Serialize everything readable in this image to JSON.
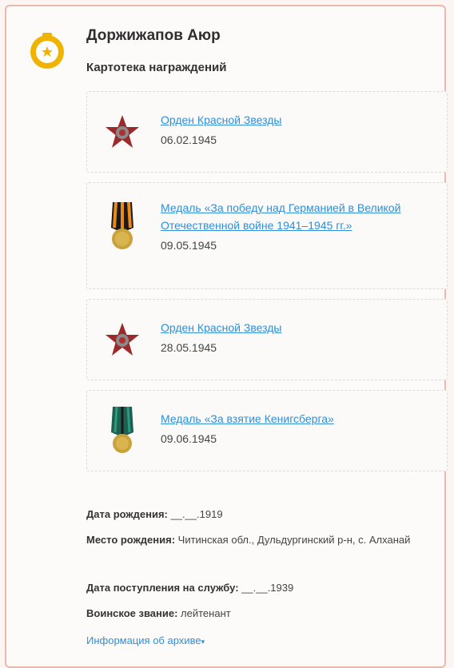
{
  "person": {
    "name": "Доржижапов Аюр",
    "subtitle": "Картотека награждений"
  },
  "awards": [
    {
      "title": "Орден Красной Звезды",
      "date": "06.02.1945",
      "icon": "red-star-order-icon"
    },
    {
      "title": "Медаль «За победу над Германией в Великой Отечественной войне 1941–1945 гг.»",
      "date": "09.05.1945",
      "icon": "victory-medal-icon"
    },
    {
      "title": "Орден Красной Звезды",
      "date": "28.05.1945",
      "icon": "red-star-order-icon"
    },
    {
      "title": "Медаль «За взятие Кенигсберга»",
      "date": "09.06.1945",
      "icon": "konigsberg-medal-icon"
    }
  ],
  "details": {
    "birth_date_label": "Дата рождения:",
    "birth_date_value": " __.__.1919",
    "birth_place_label": "Место рождения:",
    "birth_place_value": " Читинская обл., Дульдургинский р-н, с. Алханай",
    "service_date_label": "Дата поступления на службу:",
    "service_date_value": " __.__.1939",
    "rank_label": "Воинское звание:",
    "rank_value": " лейтенант"
  },
  "archive_link": "Информация об архиве",
  "archive_link_arrow": "▾",
  "colors": {
    "link": "#2f8fd8",
    "border": "#ecb7ad",
    "avatar": "#f0b400"
  }
}
